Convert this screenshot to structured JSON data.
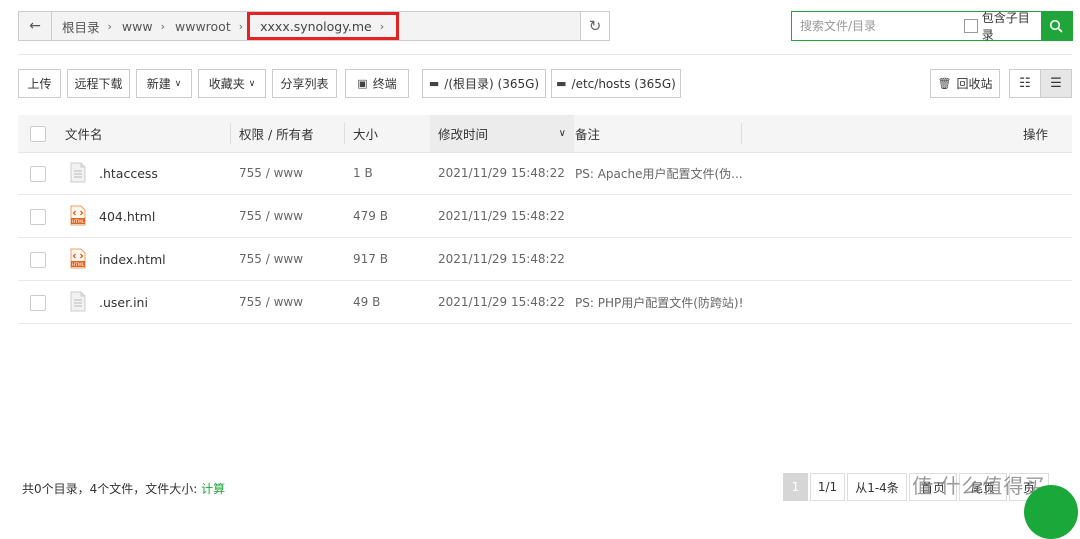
{
  "breadcrumb": {
    "items": [
      "根目录",
      "www",
      "wwwroot",
      "xxxx.synology.me"
    ]
  },
  "search": {
    "placeholder": "搜索文件/目录",
    "subdir_label": "包含子目录"
  },
  "toolbar": {
    "upload": "上传",
    "remote_download": "远程下载",
    "new": "新建",
    "favorites": "收藏夹",
    "share_list": "分享列表",
    "terminal": "终端",
    "disk_root": "/(根目录) (365G)",
    "disk_hosts": "/etc/hosts (365G)",
    "recycle": "回收站"
  },
  "table": {
    "headers": {
      "name": "文件名",
      "perm": "权限 / 所有者",
      "size": "大小",
      "mtime": "修改时间",
      "note": "备注",
      "action": "操作"
    },
    "rows": [
      {
        "icon": "text-file-icon",
        "name": ".htaccess",
        "perm": "755 / www",
        "size": "1 B",
        "mtime": "2021/11/29 15:48:22",
        "note": "PS: Apache用户配置文件(伪..."
      },
      {
        "icon": "html-file-icon",
        "name": "404.html",
        "perm": "755 / www",
        "size": "479 B",
        "mtime": "2021/11/29 15:48:22",
        "note": ""
      },
      {
        "icon": "html-file-icon",
        "name": "index.html",
        "perm": "755 / www",
        "size": "917 B",
        "mtime": "2021/11/29 15:48:22",
        "note": ""
      },
      {
        "icon": "text-file-icon",
        "name": ".user.ini",
        "perm": "755 / www",
        "size": "49 B",
        "mtime": "2021/11/29 15:48:22",
        "note": "PS: PHP用户配置文件(防跨站)!"
      }
    ]
  },
  "footer": {
    "summary": "共0个目录，4个文件，文件大小:",
    "calc": "计算",
    "page_current": "1",
    "page_total": "1/1",
    "range": "从1-4条",
    "first": "首页",
    "last": "尾页",
    "extra": "页"
  },
  "watermark": "值 什么值得买",
  "colors": {
    "accent": "#20a53a",
    "highlight_border": "#e52222"
  }
}
